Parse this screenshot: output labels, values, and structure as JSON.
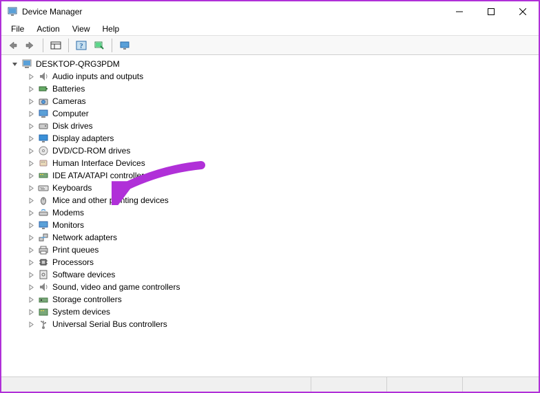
{
  "window": {
    "title": "Device Manager"
  },
  "menu": {
    "file": "File",
    "action": "Action",
    "view": "View",
    "help": "Help"
  },
  "tree": {
    "root": "DESKTOP-QRG3PDM",
    "items": [
      {
        "label": "Audio inputs and outputs"
      },
      {
        "label": "Batteries"
      },
      {
        "label": "Cameras"
      },
      {
        "label": "Computer"
      },
      {
        "label": "Disk drives"
      },
      {
        "label": "Display adapters"
      },
      {
        "label": "DVD/CD-ROM drives"
      },
      {
        "label": "Human Interface Devices"
      },
      {
        "label": "IDE ATA/ATAPI controllers"
      },
      {
        "label": "Keyboards"
      },
      {
        "label": "Mice and other pointing devices"
      },
      {
        "label": "Modems"
      },
      {
        "label": "Monitors"
      },
      {
        "label": "Network adapters"
      },
      {
        "label": "Print queues"
      },
      {
        "label": "Processors"
      },
      {
        "label": "Software devices"
      },
      {
        "label": "Sound, video and game controllers"
      },
      {
        "label": "Storage controllers"
      },
      {
        "label": "System devices"
      },
      {
        "label": "Universal Serial Bus controllers"
      }
    ]
  },
  "annotation": {
    "target": "Display adapters",
    "color": "#b030d8"
  }
}
